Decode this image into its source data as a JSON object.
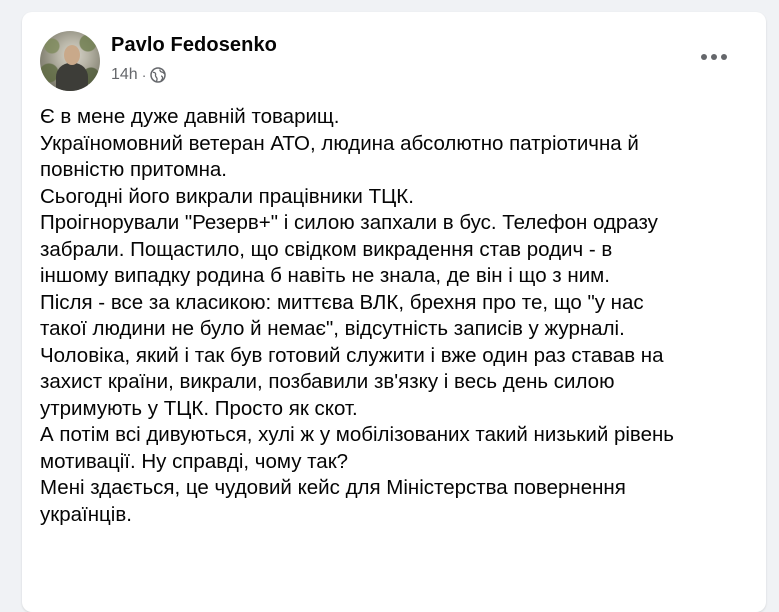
{
  "post": {
    "author": "Pavlo Fedosenko",
    "time": "14h",
    "dot": "·",
    "privacy_icon": "globe-icon",
    "more_icon": "more-horizontal-icon",
    "lines": [
      "Є в мене дуже давній товарищ.",
      "Україномовний ветеран АТО, людина абсолютно патріотична й",
      "повністю притомна.",
      "Сьогодні його викрали працівники ТЦК.",
      "Проігнорували \"Резерв+\" і силою запхали в бус. Телефон одразу",
      "забрали. Пощастило, що свідком викрадення став родич - в",
      "іншому випадку родина б навіть не знала, де він і що з ним.",
      "Після - все за класикою: миттєва ВЛК, брехня про те, що \"у нас",
      "такої людини не було й немає\", відсутність записів у журналі.",
      "Чоловіка, який і так був готовий служити і вже один раз ставав на",
      "захист країни, викрали, позбавили зв'язку і весь день силою",
      "утримують у ТЦК. Просто як скот.",
      "А потім всі дивуються, хулі ж у мобілізованих такий низький рівень",
      "мотивації. Ну справді, чому так?",
      "Мені здається, це чудовий кейс для Міністерства повернення",
      "українців."
    ]
  }
}
